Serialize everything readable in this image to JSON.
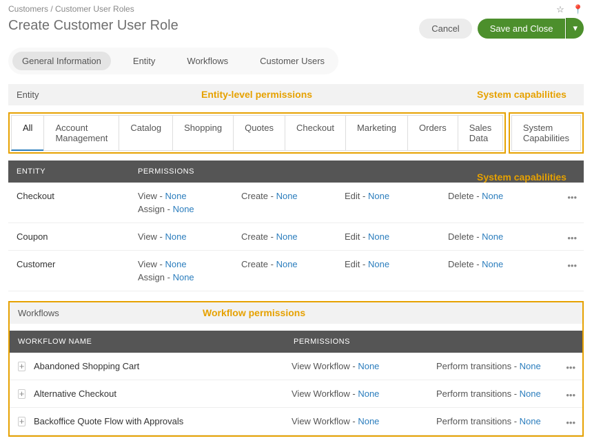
{
  "breadcrumb": "Customers / Customer User Roles",
  "page_title": "Create Customer User Role",
  "actions": {
    "cancel": "Cancel",
    "save": "Save and Close"
  },
  "top_tabs": [
    "General Information",
    "Entity",
    "Workflows",
    "Customer Users"
  ],
  "section_entity": "Entity",
  "section_workflows": "Workflows",
  "annotations": {
    "entity_level": "Entity-level permissions",
    "system_caps": "System capabilities",
    "workflow": "Workflow permissions"
  },
  "perm_tabs_left": [
    "All",
    "Account Management",
    "Catalog",
    "Shopping",
    "Quotes",
    "Checkout",
    "Marketing",
    "Orders",
    "Sales Data"
  ],
  "perm_tabs_right": [
    "System Capabilities"
  ],
  "entity_table": {
    "headers": {
      "entity": "Entity",
      "permissions": "Permissions"
    },
    "perm_labels": {
      "view": "View",
      "create": "Create",
      "edit": "Edit",
      "delete": "Delete",
      "assign": "Assign"
    },
    "none": "None",
    "rows": [
      {
        "entity": "Checkout",
        "has_assign": true
      },
      {
        "entity": "Coupon",
        "has_assign": false
      },
      {
        "entity": "Customer",
        "has_assign": true
      }
    ]
  },
  "workflow_table": {
    "headers": {
      "name": "Workflow Name",
      "permissions": "Permissions"
    },
    "perm_labels": {
      "view": "View Workflow",
      "transition": "Perform transitions"
    },
    "none": "None",
    "rows": [
      {
        "name": "Abandoned Shopping Cart"
      },
      {
        "name": "Alternative Checkout"
      },
      {
        "name": "Backoffice Quote Flow with Approvals"
      }
    ]
  }
}
